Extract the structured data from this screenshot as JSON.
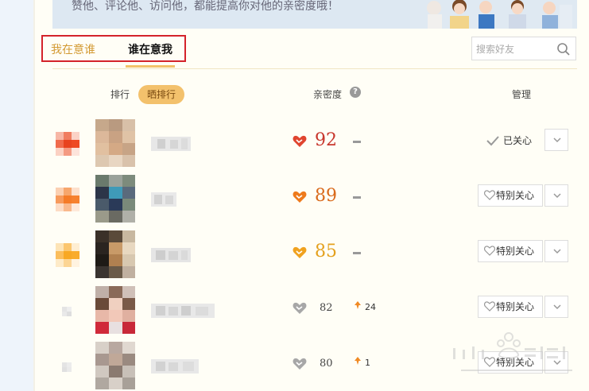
{
  "banner": {
    "text": "赞他、评论他、访问他，都能提高你对他的亲密度哦！"
  },
  "tabs": [
    {
      "label": "我在意谁",
      "active": false
    },
    {
      "label": "谁在意我",
      "active": true
    }
  ],
  "search": {
    "placeholder": "搜索好友"
  },
  "table": {
    "rank_header": "排行",
    "rank_toggle": "晒排行",
    "intimacy_header": "亲密度",
    "manage_header": "管理"
  },
  "rows": [
    {
      "score": "92",
      "score_color": "#c8372d",
      "heart_color": "#e0452f",
      "badge_color": "#e8431f",
      "trend": null,
      "action": "已关心",
      "action_type": "cared"
    },
    {
      "score": "89",
      "score_color": "#d96a1c",
      "heart_color": "#ee7a1c",
      "badge_color": "#f57b28",
      "trend": null,
      "action": "特别关心",
      "action_type": "button"
    },
    {
      "score": "85",
      "score_color": "#e4a11e",
      "heart_color": "#f0a21f",
      "badge_color": "#f8a824",
      "trend": null,
      "action": "特别关心",
      "action_type": "button"
    },
    {
      "score": "82",
      "score_color": "#444444",
      "heart_color": "#a7a7a7",
      "badge_color": "#dddddd",
      "trend": "24",
      "action": "特别关心",
      "action_type": "button"
    },
    {
      "score": "80",
      "score_color": "#444444",
      "heart_color": "#a7a7a7",
      "badge_color": "#dddddd",
      "trend": "1",
      "action": "特别关心",
      "action_type": "button"
    }
  ]
}
